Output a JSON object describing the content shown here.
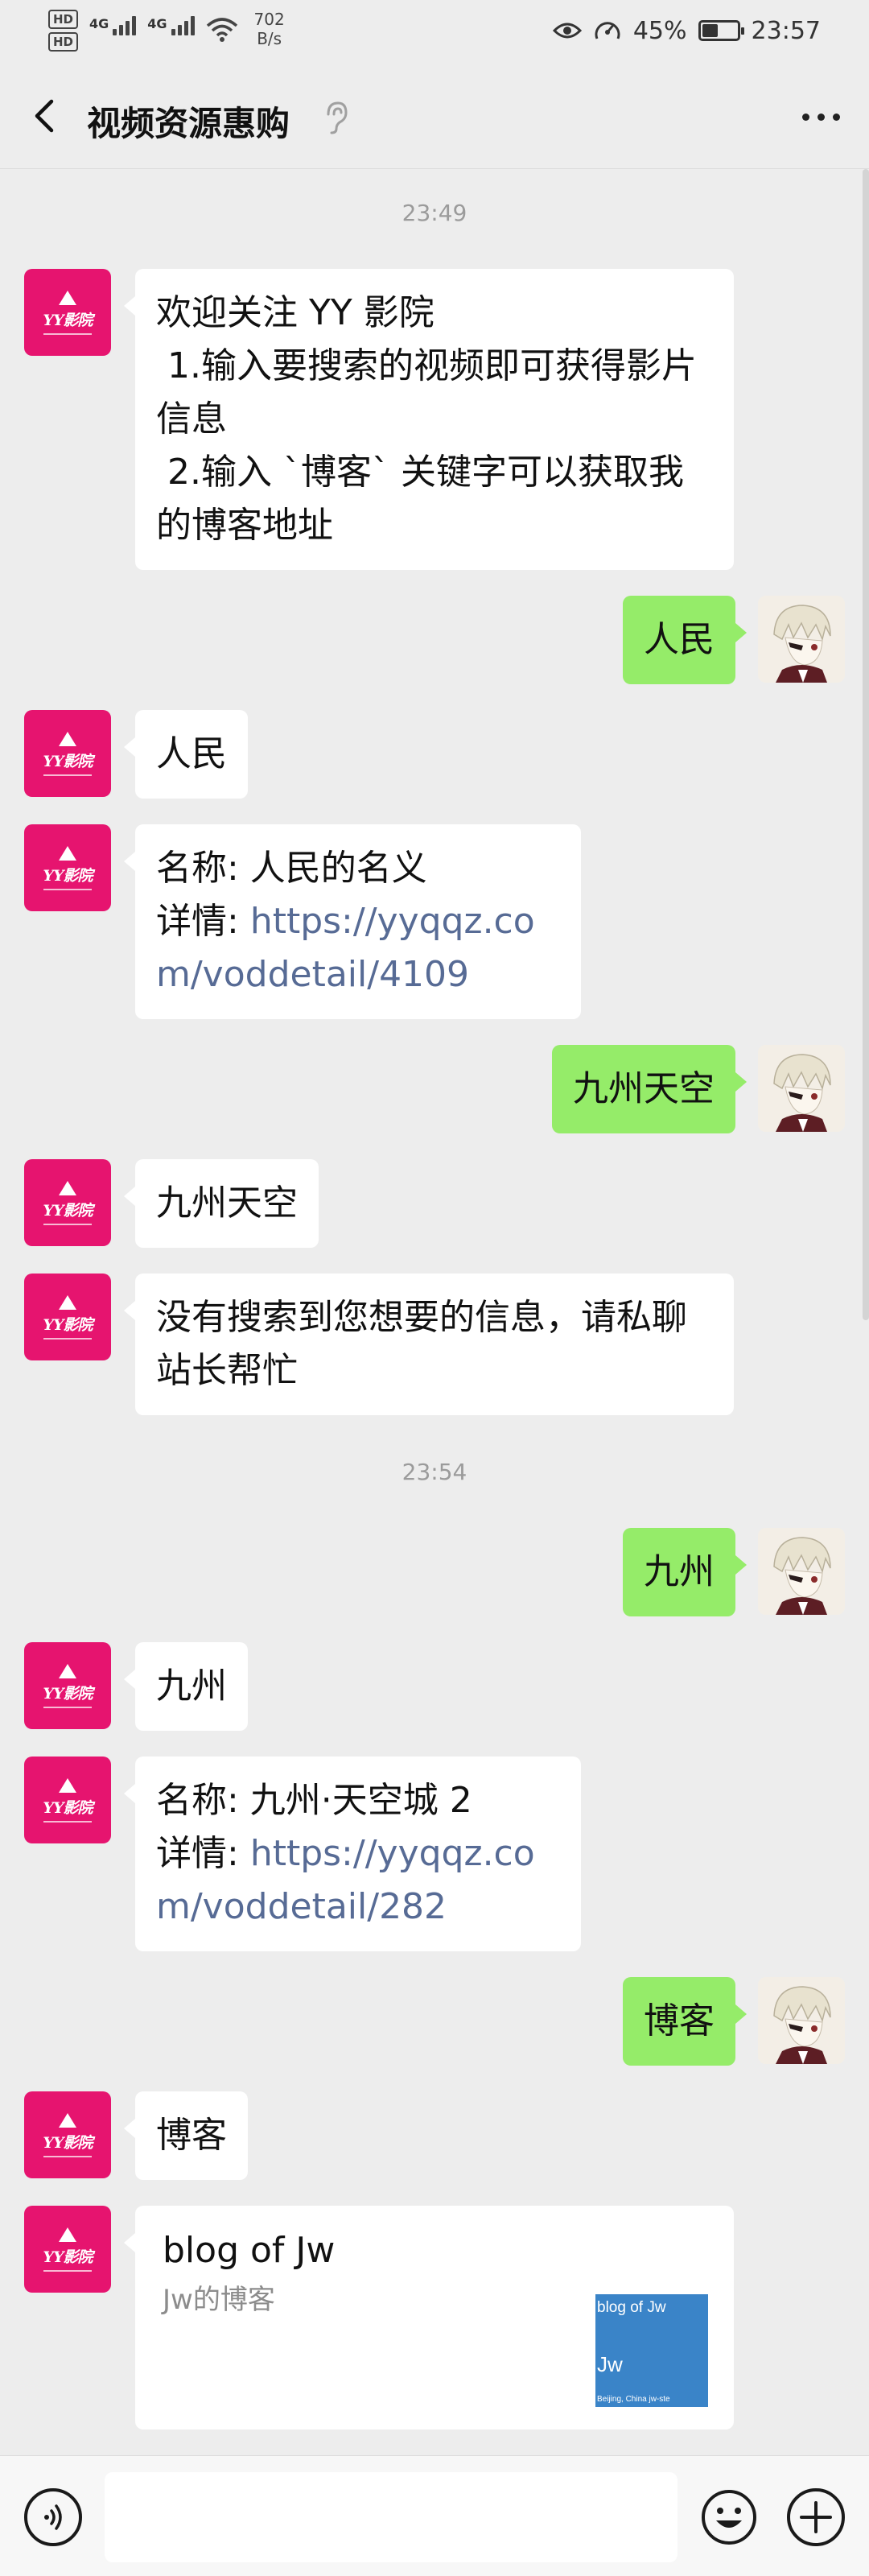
{
  "status_bar": {
    "hd1": "HD",
    "hd2": "HD",
    "net1": "4G",
    "net2": "4G",
    "speed_value": "702",
    "speed_unit": "B/s",
    "battery": "45%",
    "battery_level": 0.45,
    "time": "23:57"
  },
  "header": {
    "title": "视频资源惠购"
  },
  "messages": {
    "ts1": "23:49",
    "m1": "欢迎关注 YY 影院\n 1.输入要搜索的视频即可获得影片信息\n 2.输入 `博客` 关键字可以获取我的博客地址",
    "m2": "人民",
    "m3": "人民",
    "m4_line1": "名称: 人民的名义",
    "m4_prefix": "详情: ",
    "m4_link": "https://yyqqz.com/voddetail/4109",
    "m5": "九州天空",
    "m6": "九州天空",
    "m7": "没有搜索到您想要的信息，请私聊站长帮忙",
    "ts2": "23:54",
    "m8": "九州",
    "m9": "九州",
    "m10_line1": "名称: 九州·天空城 2",
    "m10_prefix": "详情: ",
    "m10_link": "https://yyqqz.com/voddetail/282",
    "m11": "博客",
    "m12": "博客",
    "card": {
      "title": "blog of Jw",
      "desc": "Jw的博客",
      "thumb_title": "blog of Jw",
      "thumb_main": "Jw",
      "thumb_footer": "Beijing, China  jw-ste"
    }
  },
  "avatar_brand": "YY影院"
}
